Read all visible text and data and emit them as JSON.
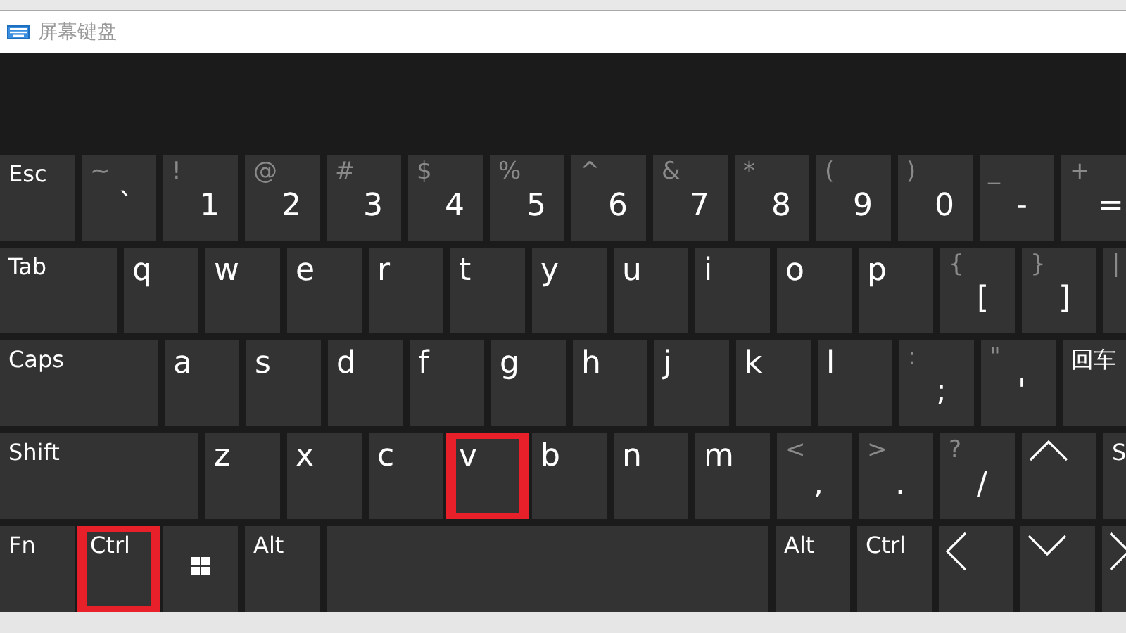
{
  "window": {
    "title": "屏幕键盘"
  },
  "rows": [
    {
      "keys": [
        {
          "kind": "word",
          "label": "Esc"
        },
        {
          "kind": "symbol",
          "shift": "~",
          "label": "`"
        },
        {
          "kind": "symbol",
          "shift": "!",
          "label": "1"
        },
        {
          "kind": "symbol",
          "shift": "@",
          "label": "2"
        },
        {
          "kind": "symbol",
          "shift": "#",
          "label": "3"
        },
        {
          "kind": "symbol",
          "shift": "$",
          "label": "4"
        },
        {
          "kind": "symbol",
          "shift": "%",
          "label": "5"
        },
        {
          "kind": "symbol",
          "shift": "^",
          "label": "6"
        },
        {
          "kind": "symbol",
          "shift": "&",
          "label": "7"
        },
        {
          "kind": "symbol",
          "shift": "*",
          "label": "8"
        },
        {
          "kind": "symbol",
          "shift": "(",
          "label": "9"
        },
        {
          "kind": "symbol",
          "shift": ")",
          "label": "0"
        },
        {
          "kind": "symbol",
          "shift": "_",
          "label": "-"
        },
        {
          "kind": "symbol",
          "shift": "+",
          "label": "="
        }
      ]
    },
    {
      "keys": [
        {
          "kind": "word",
          "label": "Tab"
        },
        {
          "kind": "letter",
          "label": "q"
        },
        {
          "kind": "letter",
          "label": "w"
        },
        {
          "kind": "letter",
          "label": "e"
        },
        {
          "kind": "letter",
          "label": "r"
        },
        {
          "kind": "letter",
          "label": "t"
        },
        {
          "kind": "letter",
          "label": "y"
        },
        {
          "kind": "letter",
          "label": "u"
        },
        {
          "kind": "letter",
          "label": "i"
        },
        {
          "kind": "letter",
          "label": "o"
        },
        {
          "kind": "letter",
          "label": "p"
        },
        {
          "kind": "symbol",
          "shift": "{",
          "label": "["
        },
        {
          "kind": "symbol",
          "shift": "}",
          "label": "]"
        },
        {
          "kind": "symbol",
          "shift": "|"
        }
      ]
    },
    {
      "keys": [
        {
          "kind": "word",
          "label": "Caps"
        },
        {
          "kind": "letter",
          "label": "a"
        },
        {
          "kind": "letter",
          "label": "s"
        },
        {
          "kind": "letter",
          "label": "d"
        },
        {
          "kind": "letter",
          "label": "f"
        },
        {
          "kind": "letter",
          "label": "g"
        },
        {
          "kind": "letter",
          "label": "h"
        },
        {
          "kind": "letter",
          "label": "j"
        },
        {
          "kind": "letter",
          "label": "k"
        },
        {
          "kind": "letter",
          "label": "l"
        },
        {
          "kind": "symbol",
          "shift": ":",
          "label": ";"
        },
        {
          "kind": "symbol",
          "shift": "\"",
          "label": "'"
        },
        {
          "kind": "word",
          "label": "回车"
        }
      ]
    },
    {
      "keys": [
        {
          "kind": "word",
          "label": "Shift"
        },
        {
          "kind": "letter",
          "label": "z"
        },
        {
          "kind": "letter",
          "label": "x"
        },
        {
          "kind": "letter",
          "label": "c"
        },
        {
          "kind": "letter",
          "label": "v",
          "highlighted": true
        },
        {
          "kind": "letter",
          "label": "b"
        },
        {
          "kind": "letter",
          "label": "n"
        },
        {
          "kind": "letter",
          "label": "m"
        },
        {
          "kind": "symbol",
          "shift": "<",
          "label": ","
        },
        {
          "kind": "symbol",
          "shift": ">",
          "label": "."
        },
        {
          "kind": "symbol",
          "shift": "?",
          "label": "/"
        },
        {
          "kind": "arrow-up"
        },
        {
          "kind": "word",
          "label": "S"
        }
      ]
    },
    {
      "keys": [
        {
          "kind": "word",
          "label": "Fn"
        },
        {
          "kind": "word",
          "label": "Ctrl",
          "highlighted": true
        },
        {
          "kind": "windows"
        },
        {
          "kind": "word",
          "label": "Alt"
        },
        {
          "kind": "space"
        },
        {
          "kind": "word",
          "label": "Alt"
        },
        {
          "kind": "word",
          "label": "Ctrl"
        },
        {
          "kind": "arrow-left"
        },
        {
          "kind": "arrow-down"
        },
        {
          "kind": "arrow-right"
        }
      ]
    }
  ]
}
